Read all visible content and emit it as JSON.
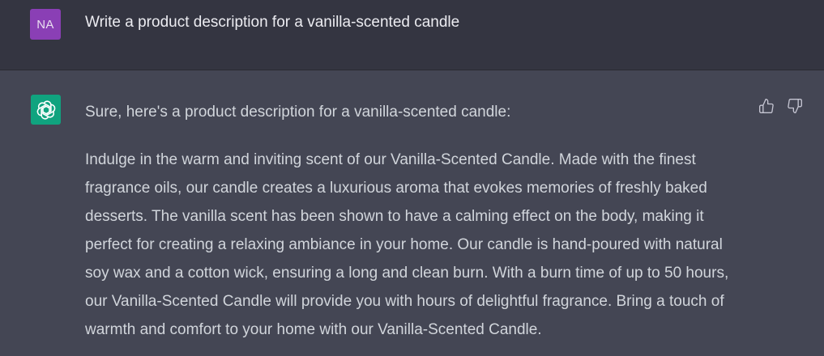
{
  "user_message": {
    "avatar_initials": "NA",
    "text": "Write a product description for a vanilla-scented candle"
  },
  "assistant_message": {
    "intro": "Sure, here's a product description for a vanilla-scented candle:",
    "body": "Indulge in the warm and inviting scent of our Vanilla-Scented Candle. Made with the finest fragrance oils, our candle creates a luxurious aroma that evokes memories of freshly baked desserts. The vanilla scent has been shown to have a calming effect on the body, making it perfect for creating a relaxing ambiance in your home. Our candle is hand-poured with natural soy wax and a cotton wick, ensuring a long and clean burn. With a burn time of up to 50 hours, our Vanilla-Scented Candle will provide you with hours of delightful fragrance. Bring a touch of warmth and comfort to your home with our Vanilla-Scented Candle."
  },
  "icons": {
    "assistant_avatar": "openai-logo-icon",
    "thumbs_up": "thumbs-up-icon",
    "thumbs_down": "thumbs-down-icon"
  },
  "colors": {
    "user_row_bg": "#343541",
    "assistant_row_bg": "#444654",
    "user_avatar_bg": "#8a3fb5",
    "assistant_avatar_bg": "#10a37f",
    "text": "#d1d5db"
  }
}
